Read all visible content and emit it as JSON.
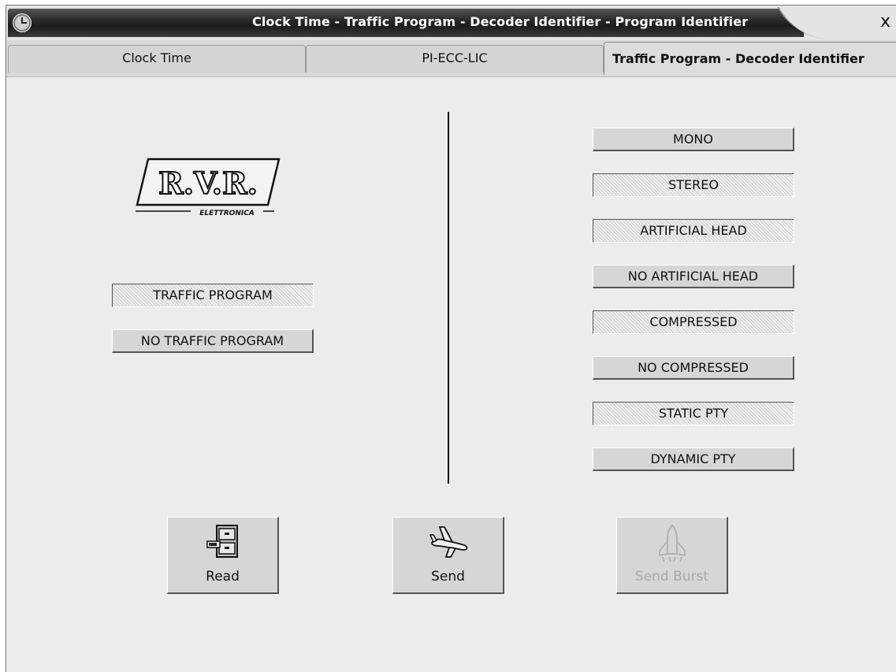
{
  "window": {
    "title": "Clock Time - Traffic Program - Decoder Identifier - Program Identifier",
    "close_label": "x"
  },
  "tabs": [
    {
      "label": "Clock Time"
    },
    {
      "label": "PI-ECC-LIC"
    },
    {
      "label": "Traffic Program - Decoder Identifier"
    }
  ],
  "logo": {
    "text": "R.V.R.",
    "subtext": "ELETTRONICA"
  },
  "traffic": {
    "tp_label": "TRAFFIC PROGRAM",
    "no_tp_label": "NO TRAFFIC PROGRAM"
  },
  "decoder": {
    "mono": "MONO",
    "stereo": "STEREO",
    "artificial_head": "ARTIFICIAL HEAD",
    "no_artificial_head": "NO ARTIFICIAL HEAD",
    "compressed": "COMPRESSED",
    "no_compressed": "NO COMPRESSED",
    "static_pty": "STATIC PTY",
    "dynamic_pty": "DYNAMIC PTY"
  },
  "actions": {
    "read": "Read",
    "send": "Send",
    "send_burst": "Send Burst"
  }
}
